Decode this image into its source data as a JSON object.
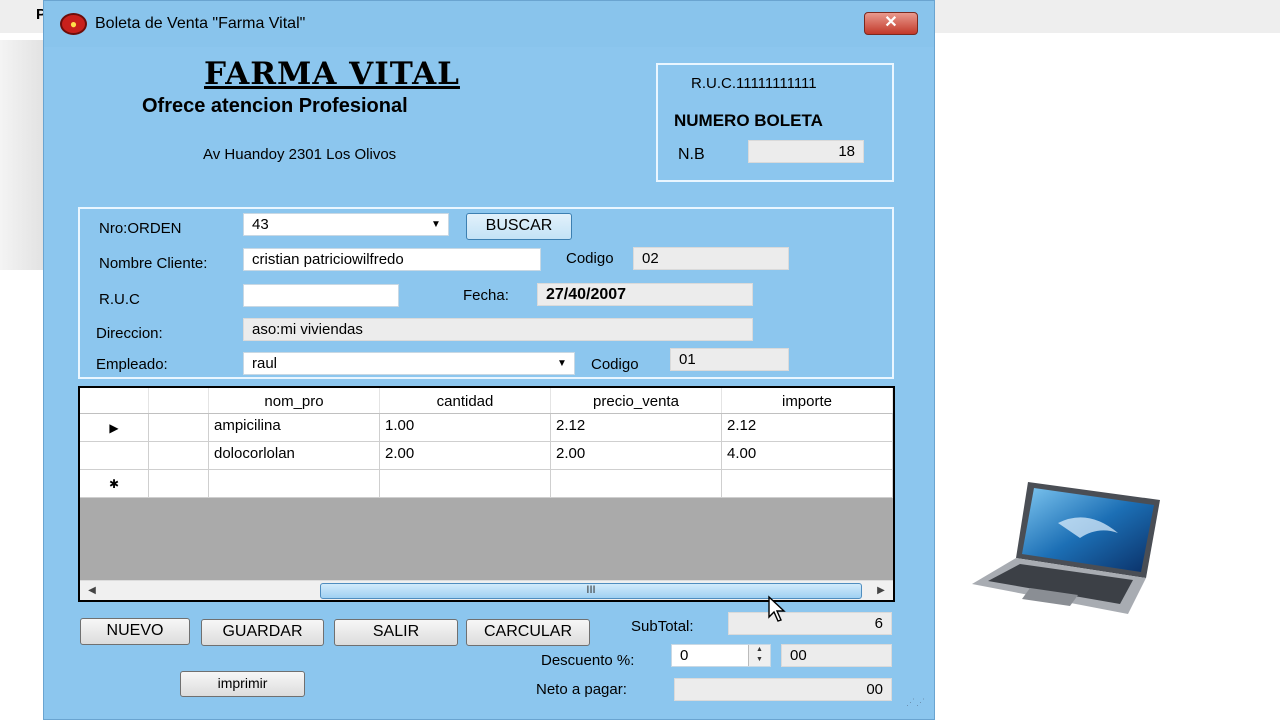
{
  "window": {
    "title": "Boleta de Venta \"Farma Vital\"",
    "close_glyph": "✕"
  },
  "background": {
    "partial_letter": "P"
  },
  "header": {
    "brand": "FARMA VITAL",
    "tagline": "Ofrece atencion Profesional",
    "address": "Av Huandoy 2301 Los Olivos"
  },
  "ruc_box": {
    "ruc": "R.U.C.11111111111",
    "title": "NUMERO BOLETA",
    "nb_label": "N.B",
    "nb_value": "18"
  },
  "form": {
    "orden_label": "Nro:ORDEN",
    "orden_value": "43",
    "buscar_label": "BUSCAR",
    "cliente_label": "Nombre Cliente:",
    "cliente_value": "cristian patriciowilfredo",
    "codigo_cliente_label": "Codigo",
    "codigo_cliente_value": "02",
    "ruc_label": "R.U.C",
    "ruc_value": "",
    "fecha_label": "Fecha:",
    "fecha_value": "27/40/2007",
    "direccion_label": "Direccion:",
    "direccion_value": "aso:mi viviendas",
    "empleado_label": "Empleado:",
    "empleado_value": "raul",
    "codigo_empleado_label": "Codigo",
    "codigo_empleado_value": "01"
  },
  "grid": {
    "columns": [
      "",
      "nom_pro",
      "cantidad",
      "precio_venta",
      "importe"
    ],
    "current_row_marker": "▶",
    "new_row_marker": "✱",
    "rows": [
      {
        "nom_pro": "ampicilina",
        "cantidad": "1.00",
        "precio_venta": "2.12",
        "importe": "2.12"
      },
      {
        "nom_pro": "dolocorlolan",
        "cantidad": "2.00",
        "precio_venta": "2.00",
        "importe": "4.00"
      }
    ],
    "scroll_left": "◀",
    "scroll_right": "▶",
    "scroll_grip": "III"
  },
  "actions": {
    "nuevo": "NUEVO",
    "guardar": "GUARDAR",
    "salir": "SALIR",
    "carcular": "CARCULAR",
    "imprimir": "imprimir"
  },
  "totals": {
    "subtotal_label": "SubTotal:",
    "subtotal_value": "6",
    "descuento_label": "Descuento %:",
    "descuento_pct": "0",
    "descuento_value": "00",
    "neto_label": "Neto a pagar:",
    "neto_value": "00"
  },
  "colors": {
    "form_background": "#8cc6ee",
    "close_button": "#c2392a",
    "grid_empty_area": "#aaaaaa"
  },
  "icons": [
    "app-icon",
    "close-icon",
    "dropdown-arrow-icon",
    "row-pointer-icon",
    "new-row-icon",
    "laptop-image",
    "mouse-cursor-icon",
    "resize-grip-icon"
  ]
}
